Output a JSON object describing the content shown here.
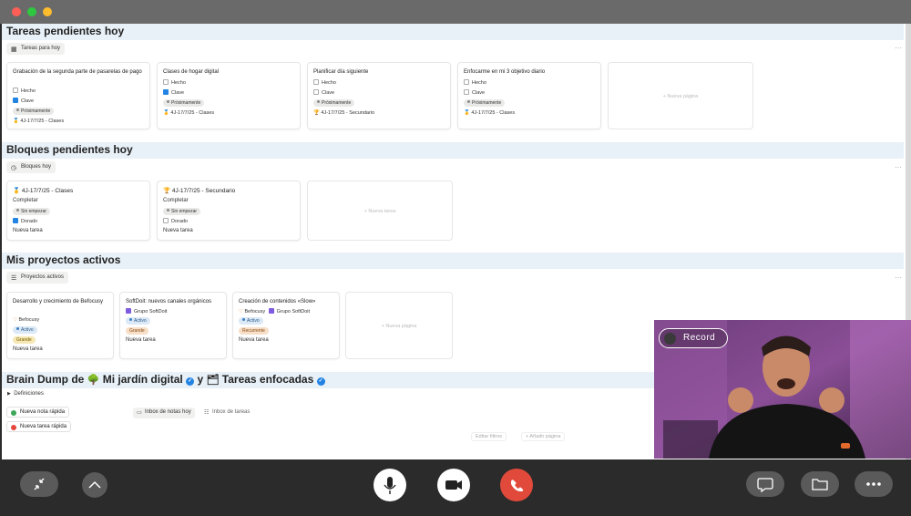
{
  "colors": {
    "accent": "#2383e2",
    "section_bg": "#e8f1f8",
    "end_call": "#e14a3b"
  },
  "sections": {
    "tareas": {
      "title": "Tareas pendientes hoy",
      "view_tab": "Tareas para hoy",
      "cards": [
        {
          "title": "Grabación de la segunda parte de pasarelas de pago",
          "hecho": "Hecho",
          "clave": "Clave",
          "status": "Próximamente",
          "ref": "4J-17/7/25 - Clases"
        },
        {
          "title": "Clases de hogar digital",
          "hecho": "Hecho",
          "clave": "Clave",
          "status": "Próximamente",
          "ref": "4J-17/7/25 - Clases"
        },
        {
          "title": "Planificar día siguiente",
          "hecho": "Hecho",
          "clave": "Clave",
          "status": "Próximamente",
          "ref": "4J-17/7/25 - Secundario"
        },
        {
          "title": "Enfocarme en mi 3 objetivo diario",
          "hecho": "Hecho",
          "clave": "Clave",
          "status": "Próximamente",
          "ref": "4J-17/7/25 - Clases"
        }
      ],
      "new_label": "+ Nueva página"
    },
    "bloques": {
      "title": "Bloques pendientes hoy",
      "view_tab": "Bloques hoy",
      "cards": [
        {
          "title": "4J-17/7/25 - Clases",
          "completar": "Completar",
          "status": "Sin empezar",
          "dorado": "Dorado",
          "nueva": "Nueva tarea"
        },
        {
          "title": "4J-17/7/25 - Secundario",
          "completar": "Completar",
          "status": "Sin empezar",
          "dorado": "Dorado",
          "nueva": "Nueva tarea"
        }
      ],
      "new_label": "+ Nueva tarea"
    },
    "proyectos": {
      "title": "Mis proyectos activos",
      "view_tab": "Proyectos activos",
      "cards": [
        {
          "title": "Desarrollo y crecimiento de Befocusy",
          "owner": "Befocusy",
          "status": "Activo",
          "size": "Grande",
          "nueva": "Nueva tarea"
        },
        {
          "title": "SoftDoit: nuevos canales orgánicos",
          "group": "Grupo SoftDoit",
          "status": "Activo",
          "size": "Grande",
          "nueva": "Nueva tarea"
        },
        {
          "title": "Creación de contenidos «Slow»",
          "owner": "Befocusy",
          "group": "Grupo SoftDoit",
          "status": "Activo",
          "size": "Recurrente",
          "nueva": "Nueva tarea"
        }
      ],
      "new_label": "+ Nueva página"
    },
    "brain": {
      "title_part1": "Brain Dump de",
      "title_part2": "Mi jardín digital",
      "title_part3": "y",
      "title_part4": "Tareas enfocadas",
      "toggle": "Definiciones",
      "quick_note": "Nueva nota rápida",
      "quick_task": "Nueva tarea rápida",
      "tab_notes": "Inbox de notas hoy",
      "tab_tasks": "Inbox de tareas",
      "edit_filters": "Editar filtros",
      "add_page": "+ Añadir página"
    }
  },
  "video": {
    "record_label": "Record"
  }
}
